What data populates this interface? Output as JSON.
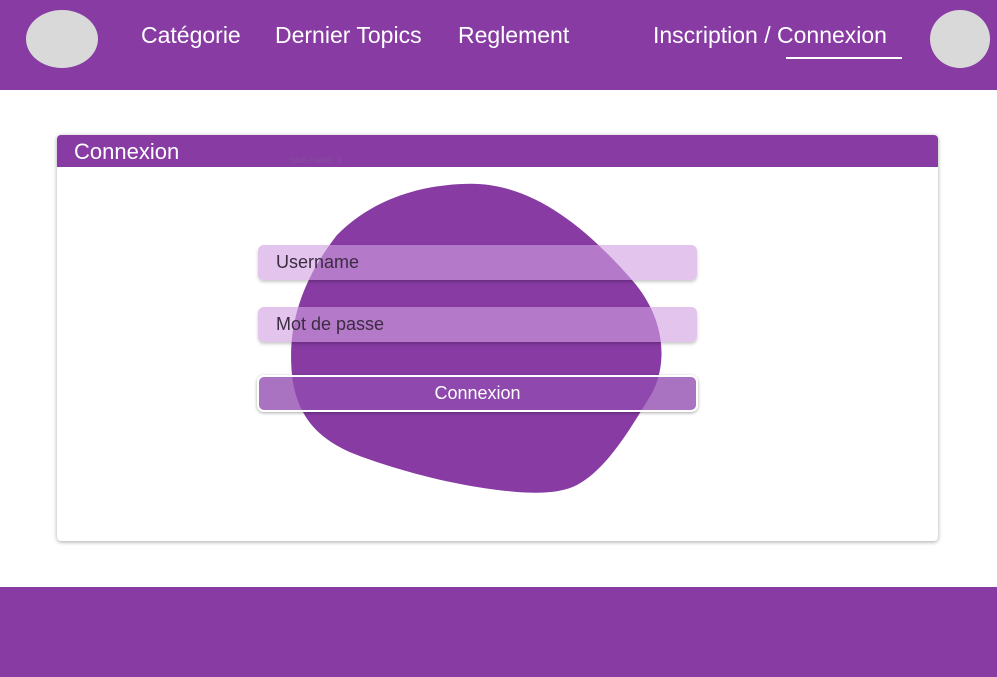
{
  "header": {
    "nav_items": [
      "Catégorie",
      "Dernier Topics",
      "Reglement"
    ],
    "auth_inscription": "Inscription",
    "auth_separator": " / ",
    "auth_connexion": "Connexion"
  },
  "login_card": {
    "title": "Connexion",
    "blob_label": "blob-haikei 3",
    "username_placeholder": "Username",
    "password_placeholder": "Mot de passe",
    "submit_label": "Connexion"
  },
  "colors": {
    "brand": "#873ba3",
    "avatar": "#d9d9d9"
  }
}
